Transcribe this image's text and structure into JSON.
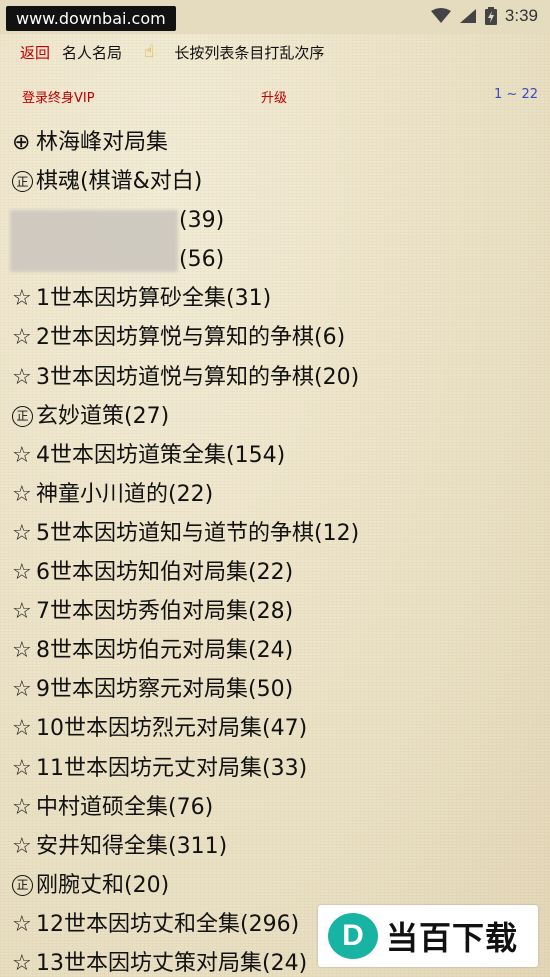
{
  "status_bar": {
    "watermark_url": "www.downbai.com",
    "time": "3:39"
  },
  "header": {
    "back_label": "返回",
    "title": "名人名局",
    "hand_icon": "☝",
    "hint": "长按列表条目打乱次序"
  },
  "actions": {
    "vip_label": "登录终身VIP",
    "upgrade_label": "升级",
    "page_range": "1 ~ 22"
  },
  "items": [
    {
      "marker": "⊕",
      "marker_type": "plain",
      "label": "林海峰对局集"
    },
    {
      "marker": "正",
      "marker_type": "circle",
      "label": "棋魂(棋谱&对白)"
    },
    {
      "marker": "",
      "marker_type": "blurred",
      "label": "(39)"
    },
    {
      "marker": "",
      "marker_type": "blurred",
      "label": "(56)"
    },
    {
      "marker": "☆",
      "marker_type": "plain",
      "label": "1世本因坊算砂全集(31)"
    },
    {
      "marker": "☆",
      "marker_type": "plain",
      "label": "2世本因坊算悦与算知的争棋(6)"
    },
    {
      "marker": "☆",
      "marker_type": "plain",
      "label": "3世本因坊道悦与算知的争棋(20)"
    },
    {
      "marker": "正",
      "marker_type": "circle",
      "label": "玄妙道策(27)"
    },
    {
      "marker": "☆",
      "marker_type": "plain",
      "label": "4世本因坊道策全集(154)"
    },
    {
      "marker": "☆",
      "marker_type": "plain",
      "label": "神童小川道的(22)"
    },
    {
      "marker": "☆",
      "marker_type": "plain",
      "label": "5世本因坊道知与道节的争棋(12)"
    },
    {
      "marker": "☆",
      "marker_type": "plain",
      "label": "6世本因坊知伯对局集(22)"
    },
    {
      "marker": "☆",
      "marker_type": "plain",
      "label": "7世本因坊秀伯对局集(28)"
    },
    {
      "marker": "☆",
      "marker_type": "plain",
      "label": "8世本因坊伯元对局集(24)"
    },
    {
      "marker": "☆",
      "marker_type": "plain",
      "label": "9世本因坊察元对局集(50)"
    },
    {
      "marker": "☆",
      "marker_type": "plain",
      "label": "10世本因坊烈元对局集(47)"
    },
    {
      "marker": "☆",
      "marker_type": "plain",
      "label": "11世本因坊元丈对局集(33)"
    },
    {
      "marker": "☆",
      "marker_type": "plain",
      "label": "中村道硕全集(76)"
    },
    {
      "marker": "☆",
      "marker_type": "plain",
      "label": "安井知得全集(311)"
    },
    {
      "marker": "正",
      "marker_type": "circle",
      "label": "刚腕丈和(20)"
    },
    {
      "marker": "☆",
      "marker_type": "plain",
      "label": "12世本因坊丈和全集(296)"
    },
    {
      "marker": "☆",
      "marker_type": "plain",
      "label": "13世本因坊丈策对局集(24)"
    }
  ],
  "bottom_watermark": {
    "logo_letter": "D",
    "text": "当百下载"
  },
  "colors": {
    "link_red": "#c00000",
    "page_blue": "#3848c8",
    "background": "#ece3c8"
  }
}
